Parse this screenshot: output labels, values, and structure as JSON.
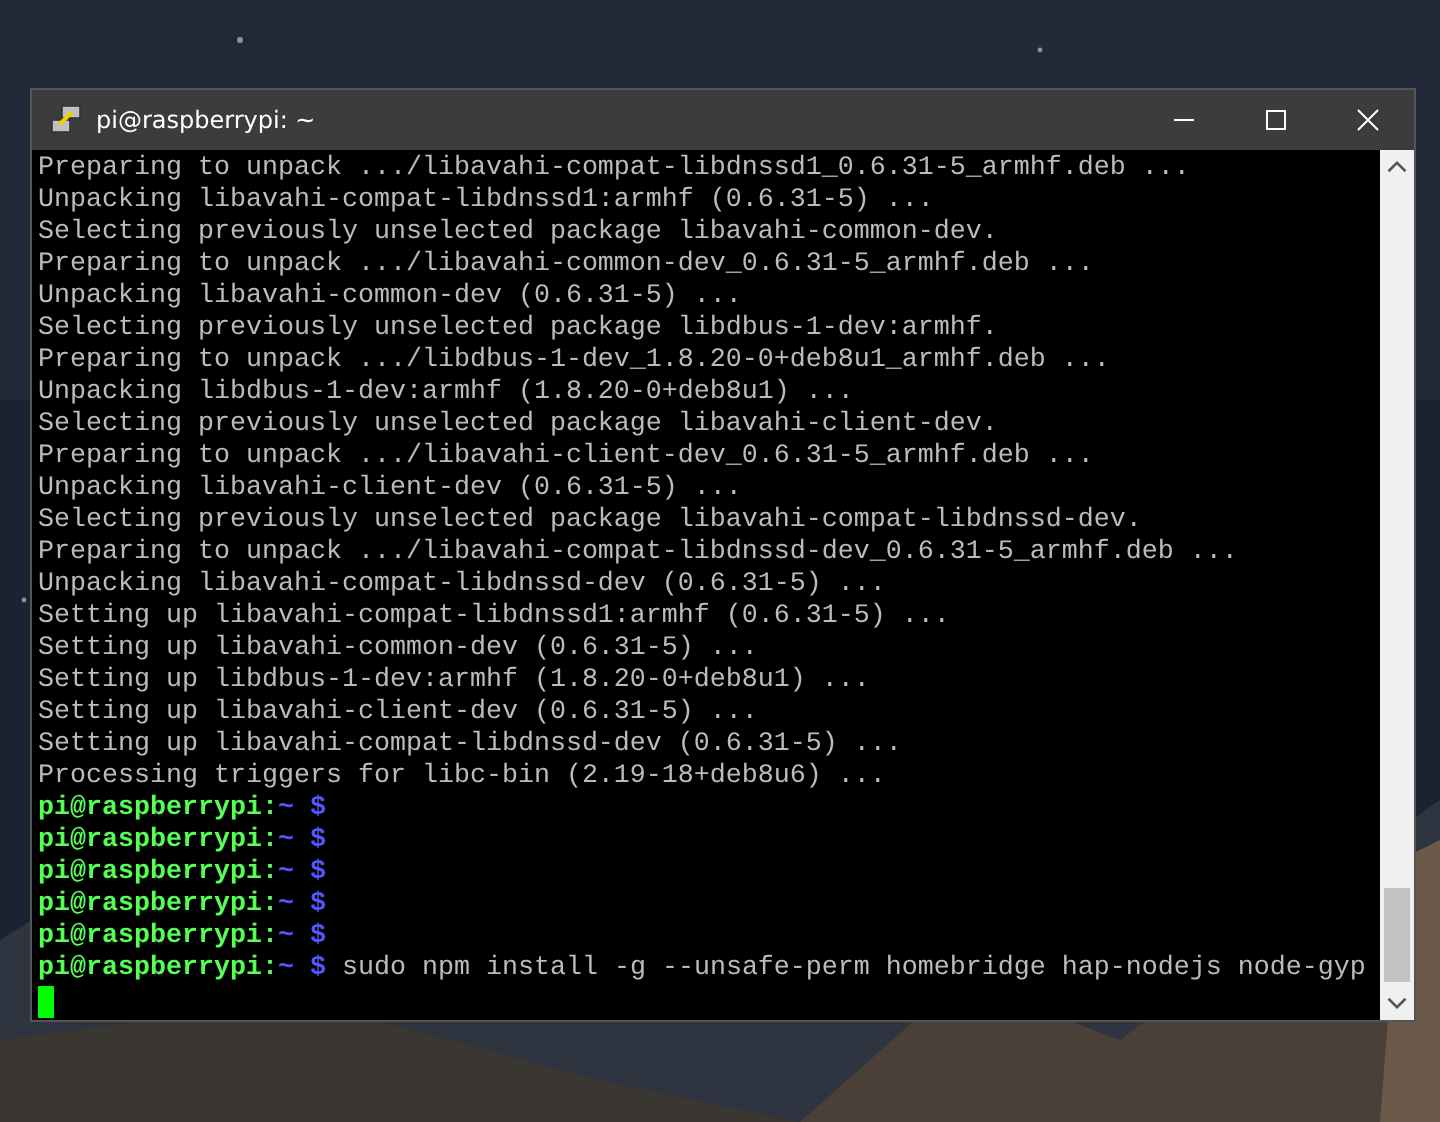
{
  "window": {
    "title": "pi@raspberrypi: ~"
  },
  "terminal": {
    "lines": [
      {
        "kind": "output",
        "text": "Preparing to unpack .../libavahi-compat-libdnssd1_0.6.31-5_armhf.deb ..."
      },
      {
        "kind": "output",
        "text": "Unpacking libavahi-compat-libdnssd1:armhf (0.6.31-5) ..."
      },
      {
        "kind": "output",
        "text": "Selecting previously unselected package libavahi-common-dev."
      },
      {
        "kind": "output",
        "text": "Preparing to unpack .../libavahi-common-dev_0.6.31-5_armhf.deb ..."
      },
      {
        "kind": "output",
        "text": "Unpacking libavahi-common-dev (0.6.31-5) ..."
      },
      {
        "kind": "output",
        "text": "Selecting previously unselected package libdbus-1-dev:armhf."
      },
      {
        "kind": "output",
        "text": "Preparing to unpack .../libdbus-1-dev_1.8.20-0+deb8u1_armhf.deb ..."
      },
      {
        "kind": "output",
        "text": "Unpacking libdbus-1-dev:armhf (1.8.20-0+deb8u1) ..."
      },
      {
        "kind": "output",
        "text": "Selecting previously unselected package libavahi-client-dev."
      },
      {
        "kind": "output",
        "text": "Preparing to unpack .../libavahi-client-dev_0.6.31-5_armhf.deb ..."
      },
      {
        "kind": "output",
        "text": "Unpacking libavahi-client-dev (0.6.31-5) ..."
      },
      {
        "kind": "output",
        "text": "Selecting previously unselected package libavahi-compat-libdnssd-dev."
      },
      {
        "kind": "output",
        "text": "Preparing to unpack .../libavahi-compat-libdnssd-dev_0.6.31-5_armhf.deb ..."
      },
      {
        "kind": "output",
        "text": "Unpacking libavahi-compat-libdnssd-dev (0.6.31-5) ..."
      },
      {
        "kind": "output",
        "text": "Setting up libavahi-compat-libdnssd1:armhf (0.6.31-5) ..."
      },
      {
        "kind": "output",
        "text": "Setting up libavahi-common-dev (0.6.31-5) ..."
      },
      {
        "kind": "output",
        "text": "Setting up libdbus-1-dev:armhf (1.8.20-0+deb8u1) ..."
      },
      {
        "kind": "output",
        "text": "Setting up libavahi-client-dev (0.6.31-5) ..."
      },
      {
        "kind": "output",
        "text": "Setting up libavahi-compat-libdnssd-dev (0.6.31-5) ..."
      },
      {
        "kind": "output",
        "text": "Processing triggers for libc-bin (2.19-18+deb8u6) ..."
      },
      {
        "kind": "prompt",
        "host": "pi@raspberrypi:",
        "path": "~",
        "symbol": "$"
      },
      {
        "kind": "prompt",
        "host": "pi@raspberrypi:",
        "path": "~",
        "symbol": "$"
      },
      {
        "kind": "prompt",
        "host": "pi@raspberrypi:",
        "path": "~",
        "symbol": "$"
      },
      {
        "kind": "prompt",
        "host": "pi@raspberrypi:",
        "path": "~",
        "symbol": "$"
      },
      {
        "kind": "prompt",
        "host": "pi@raspberrypi:",
        "path": "~",
        "symbol": "$"
      },
      {
        "kind": "prompt",
        "host": "pi@raspberrypi:",
        "path": "~",
        "symbol": "$",
        "command": "sudo npm install -g --unsafe-perm homebridge hap-nodejs node-gyp"
      },
      {
        "kind": "cursor"
      }
    ]
  }
}
